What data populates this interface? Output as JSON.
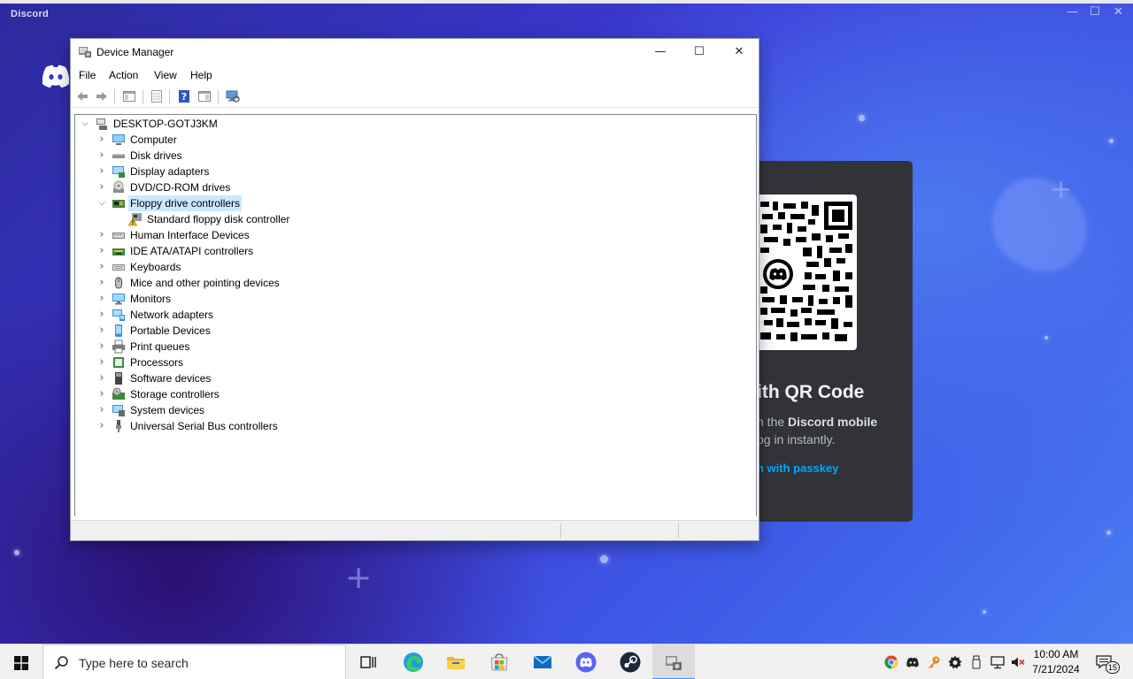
{
  "discord": {
    "title": "Discord",
    "window_controls": {
      "minimize": "—",
      "maximize": "☐",
      "close": "✕"
    },
    "qr_heading": "ith QR Code",
    "qr_desc_prefix": "n the ",
    "qr_desc_bold": "Discord mobile",
    "qr_desc_line2": "og in instantly.",
    "qr_link": "n with passkey"
  },
  "device_manager": {
    "title": "Device Manager",
    "window_controls": {
      "minimize": "—",
      "maximize": "☐",
      "close": "✕"
    },
    "menu": [
      "File",
      "Action",
      "View",
      "Help"
    ],
    "tree": {
      "root": "DESKTOP-GOTJ3KM",
      "items": [
        {
          "label": "Computer",
          "icon": "computer-icon"
        },
        {
          "label": "Disk drives",
          "icon": "disk-drive-icon"
        },
        {
          "label": "Display adapters",
          "icon": "display-adapter-icon"
        },
        {
          "label": "DVD/CD-ROM drives",
          "icon": "dvd-drive-icon"
        },
        {
          "label": "Floppy drive controllers",
          "icon": "floppy-controller-icon",
          "expanded": true,
          "selected": true,
          "children": [
            {
              "label": "Standard floppy disk controller",
              "icon": "warning-controller-icon"
            }
          ]
        },
        {
          "label": "Human Interface Devices",
          "icon": "hid-icon"
        },
        {
          "label": "IDE ATA/ATAPI controllers",
          "icon": "ide-controller-icon"
        },
        {
          "label": "Keyboards",
          "icon": "keyboard-icon"
        },
        {
          "label": "Mice and other pointing devices",
          "icon": "mouse-icon"
        },
        {
          "label": "Monitors",
          "icon": "monitor-icon"
        },
        {
          "label": "Network adapters",
          "icon": "network-adapter-icon"
        },
        {
          "label": "Portable Devices",
          "icon": "portable-device-icon"
        },
        {
          "label": "Print queues",
          "icon": "printer-icon"
        },
        {
          "label": "Processors",
          "icon": "processor-icon"
        },
        {
          "label": "Software devices",
          "icon": "software-device-icon"
        },
        {
          "label": "Storage controllers",
          "icon": "storage-controller-icon"
        },
        {
          "label": "System devices",
          "icon": "system-device-icon"
        },
        {
          "label": "Universal Serial Bus controllers",
          "icon": "usb-icon"
        }
      ]
    }
  },
  "taskbar": {
    "search_placeholder": "Type here to search",
    "apps": [
      "task-view",
      "edge",
      "file-explorer",
      "microsoft-store",
      "mail",
      "discord",
      "steam",
      "device-manager"
    ],
    "clock": {
      "time": "10:00 AM",
      "date": "7/21/2024"
    },
    "notification_count": "15"
  },
  "colors": {
    "selection": "#cce8ff",
    "discord_card": "#313338",
    "discord_link": "#00a8fc"
  }
}
